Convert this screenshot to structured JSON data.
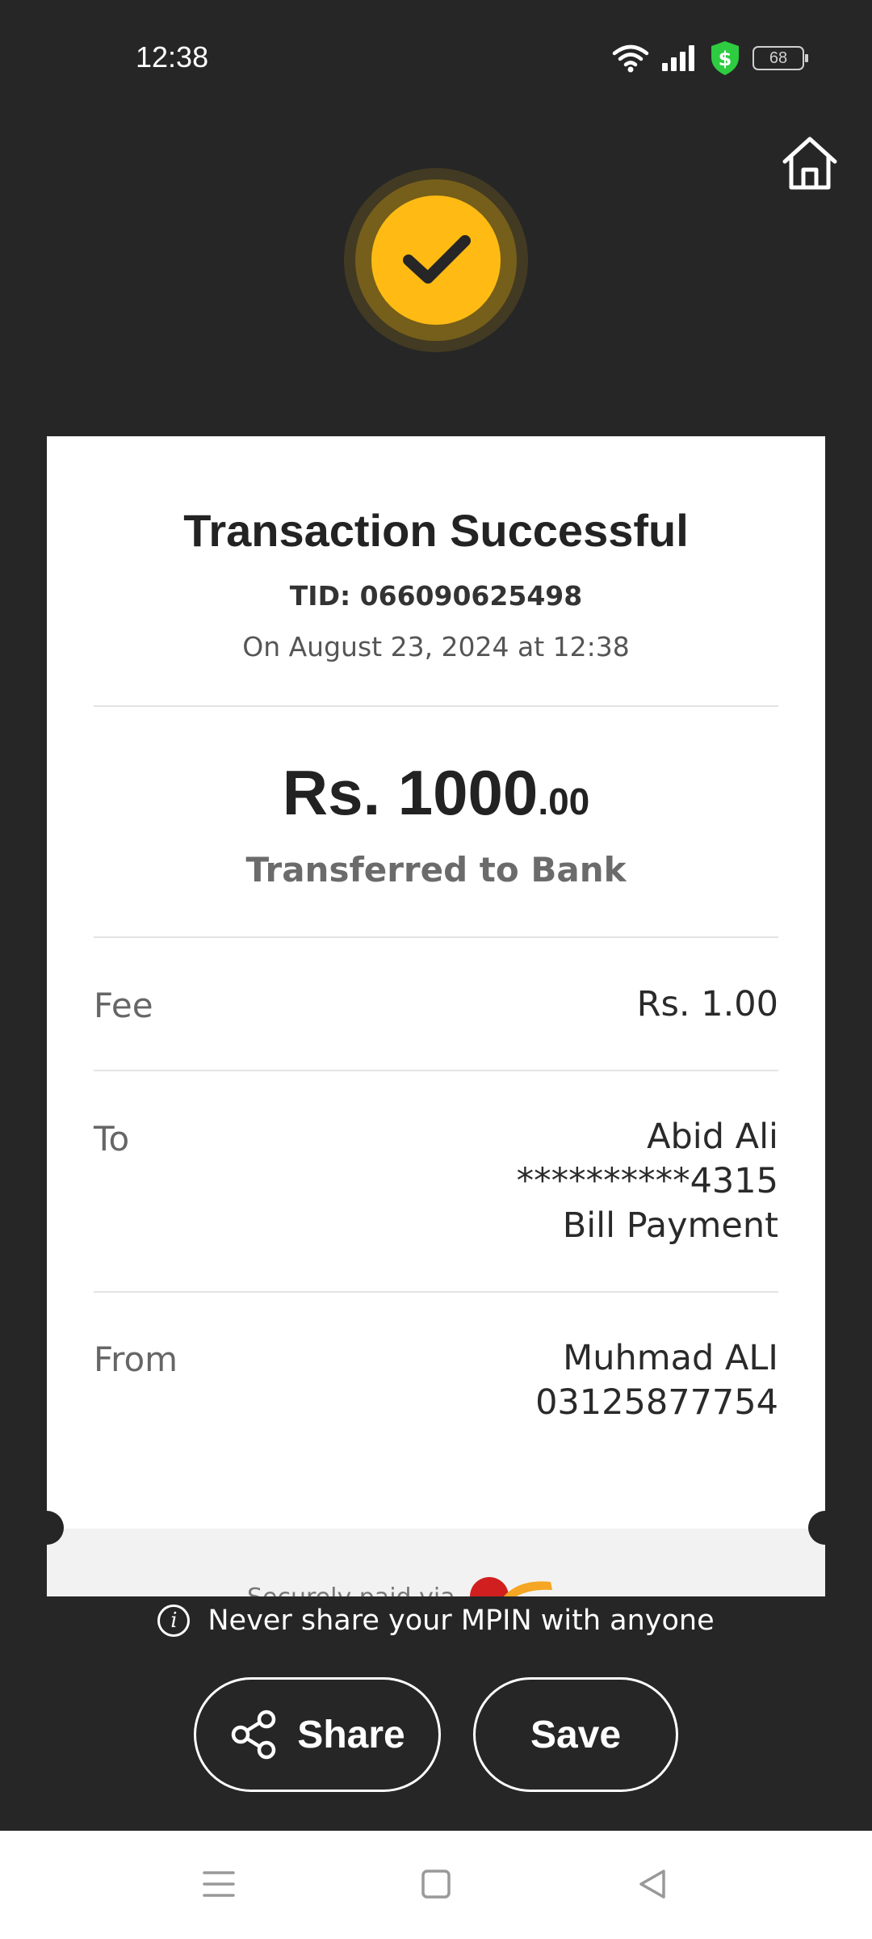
{
  "status_bar": {
    "time": "12:38",
    "battery_level": "68",
    "icons": [
      "wifi-icon",
      "signal-icon",
      "security-shield-icon",
      "battery-icon"
    ]
  },
  "header": {
    "home_icon": "home-icon",
    "status_icon": "checkmark-icon"
  },
  "receipt": {
    "title": "Transaction Successful",
    "tid": "TID: 066090625498",
    "date": "On August 23, 2024 at 12:38",
    "amount_main": "Rs. 1000",
    "amount_cents": ".00",
    "transfer_type": "Transferred to Bank",
    "fee": {
      "label": "Fee",
      "value": "Rs. 1.00"
    },
    "to": {
      "label": "To",
      "name": "Abid Ali",
      "account": "**********4315",
      "purpose": "Bill Payment"
    },
    "from": {
      "label": "From",
      "name": "Muhmad ALI",
      "number": "03125877754"
    },
    "footer": {
      "securely_paid": "Securely paid via"
    }
  },
  "notice": {
    "text": "Never share your MPIN with anyone",
    "icon": "info-icon"
  },
  "actions": {
    "share_label": "Share",
    "save_label": "Save"
  },
  "nav_bar": {
    "items": [
      "menu-icon",
      "home-square-icon",
      "back-icon"
    ]
  },
  "colors": {
    "background": "#262626",
    "accent": "#FFBB13",
    "card": "#FFFFFF"
  }
}
